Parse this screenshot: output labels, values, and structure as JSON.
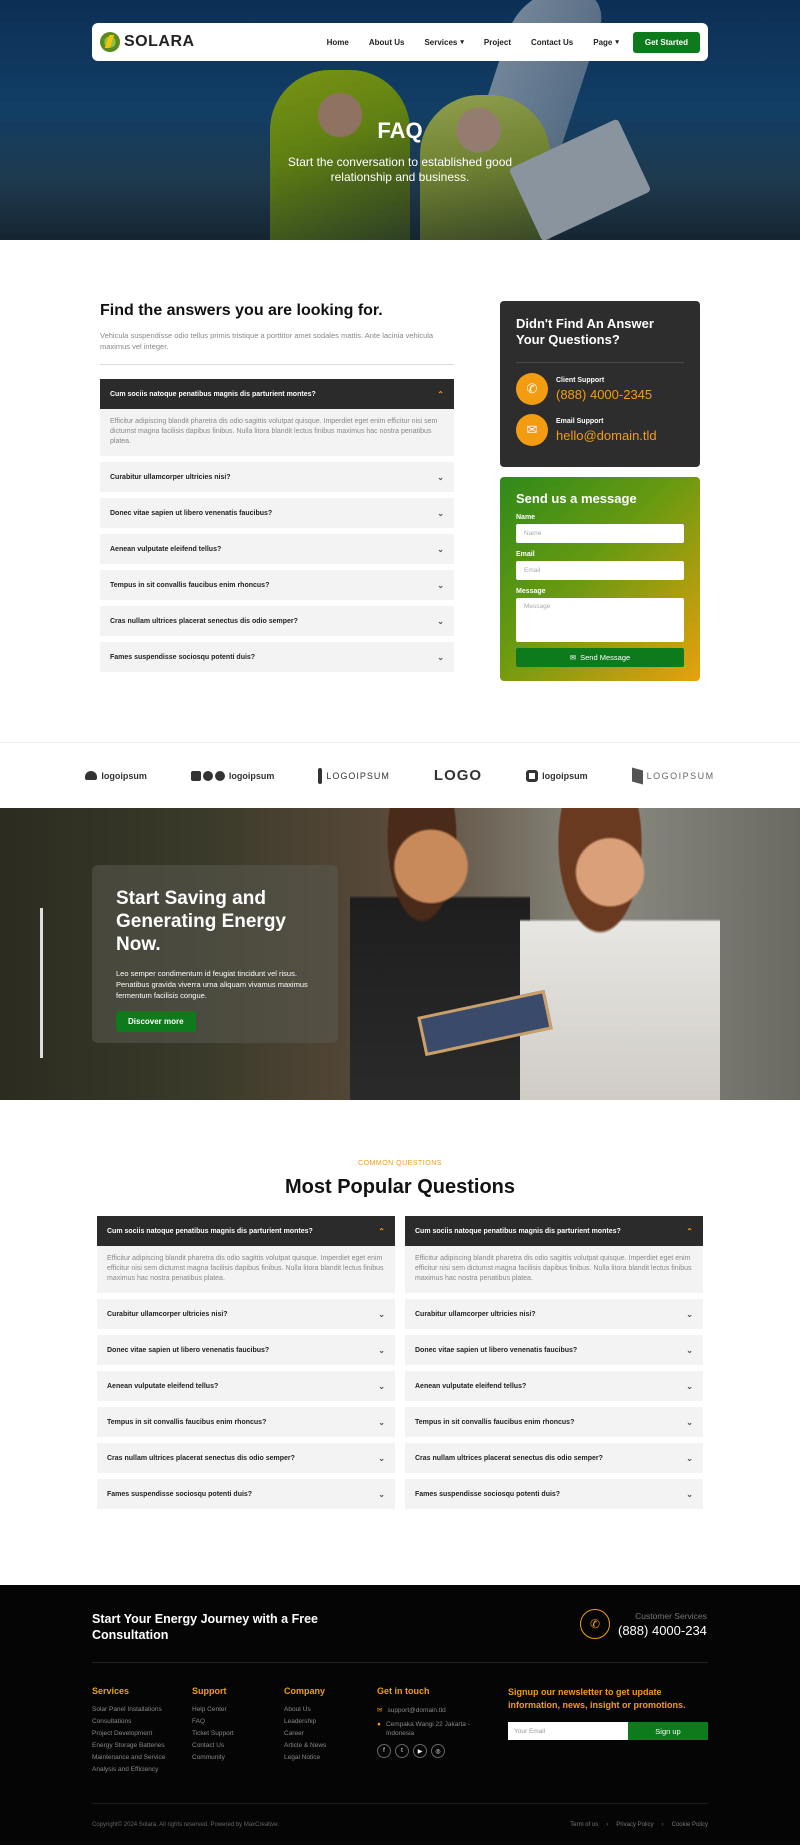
{
  "nav": {
    "logo_text": "SOLARA",
    "links": [
      "Home",
      "About Us",
      "Services",
      "Project",
      "Contact Us",
      "Page"
    ],
    "cta": "Get Started"
  },
  "hero": {
    "title": "FAQ",
    "subtitle": "Start the conversation to established good relationship and business."
  },
  "faq": {
    "heading": "Find the answers you are looking for.",
    "lead": "Vehicula suspendisse odio tellus primis tristique a porttitor amet sodales mattis. Ante lacinia vehicula maximus vel integer.",
    "open_question": "Cum sociis natoque penatibus magnis dis parturient montes?",
    "open_answer": "Efficitur adipiscing blandit pharetra dis odio sagittis volutpat quisque. Imperdiet eget enim efficitur nisi sem dictumst magna facilisis dapibus finibus. Nulla litora blandit lectus finibus maximus hac nostra penatibus platea.",
    "questions": [
      "Curabitur ullamcorper ultricies nisi?",
      "Donec vitae sapien ut libero venenatis faucibus?",
      "Aenean vulputate eleifend tellus?",
      "Tempus in sit convallis faucibus enim rhoncus?",
      "Cras nullam ultrices placerat senectus dis odio semper?",
      "Fames suspendisse sociosqu potenti duis?"
    ]
  },
  "contact_card": {
    "title": "Didn't Find An Answer Your Questions?",
    "support_label": "Client Support",
    "support_value": "(888) 4000-2345",
    "email_label": "Email Support",
    "email_value": "hello@domain.tld"
  },
  "message_form": {
    "title": "Send us a message",
    "name_label": "Name",
    "name_placeholder": "Name",
    "email_label": "Email",
    "email_placeholder": "Email",
    "message_label": "Message",
    "message_placeholder": "Message",
    "submit": "Send Message"
  },
  "logos": [
    "logoipsum",
    "logoipsum",
    "LOGOIPSUM",
    "LOGO",
    "logoipsum",
    "LOGOIPSUM"
  ],
  "banner": {
    "title": "Start Saving and Generating Energy Now.",
    "text": "Leo semper condimentum id feugiat tincidunt vel risus. Penatibus gravida viverra urna aliquam vivamus maximus fermentum facilisis congue.",
    "button": "Discover more"
  },
  "popular": {
    "eyebrow": "COMMON QUESTIONS",
    "title": "Most Popular Questions"
  },
  "footer": {
    "cta": "Start Your Energy Journey with a Free Consultation",
    "cs_label": "Customer Services",
    "cs_value": "(888) 4000-234",
    "services_head": "Services",
    "services": [
      "Solar Panel Installations",
      "Consultations",
      "Project Development",
      "Energy Storage Batteries",
      "Maintenance and Service",
      "Analysis and Efficiency"
    ],
    "support_head": "Support",
    "support": [
      "Help Center",
      "FAQ",
      "Ticket Support",
      "Contact Us",
      "Community"
    ],
    "company_head": "Company",
    "company": [
      "About Us",
      "Leadership",
      "Career",
      "Article & News",
      "Legal Notice"
    ],
    "touch_head": "Get in touch",
    "touch_email": "support@domain.tld",
    "touch_address": "Cempaka Wangi 22 Jakarta - Indonesia",
    "newsletter_title": "Signup our newsletter to get update information, news, insight or promotions.",
    "newsletter_placeholder": "Your Email",
    "newsletter_button": "Sign up",
    "copyright": "Copyright© 2024 Solara. All rights reserved. Powered by MaxCreative.",
    "legal": [
      "Term of us",
      "Privacy Policy",
      "Cookie Policy"
    ]
  },
  "colors": {
    "accent": "#f39c12",
    "brand_green": "#0d7a1b",
    "dark": "#2b2b2b"
  }
}
